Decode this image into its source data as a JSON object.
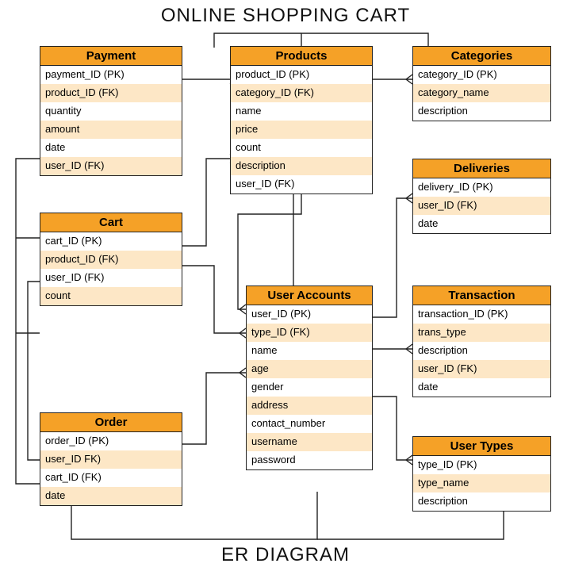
{
  "title_top": "ONLINE SHOPPING CART",
  "title_bottom": "ER DIAGRAM",
  "entities": {
    "payment": {
      "name": "Payment",
      "fields": [
        "payment_ID (PK)",
        "product_ID (FK)",
        "quantity",
        "amount",
        "date",
        "user_ID (FK)"
      ]
    },
    "products": {
      "name": "Products",
      "fields": [
        "product_ID (PK)",
        "category_ID (FK)",
        "name",
        "price",
        "count",
        "description",
        "user_ID (FK)"
      ]
    },
    "categories": {
      "name": "Categories",
      "fields": [
        "category_ID (PK)",
        "category_name",
        "description"
      ]
    },
    "deliveries": {
      "name": "Deliveries",
      "fields": [
        "delivery_ID (PK)",
        "user_ID (FK)",
        "date"
      ]
    },
    "cart": {
      "name": "Cart",
      "fields": [
        "cart_ID (PK)",
        "product_ID (FK)",
        "user_ID (FK)",
        "count"
      ]
    },
    "user_accounts": {
      "name": "User Accounts",
      "fields": [
        "user_ID (PK)",
        "type_ID (FK)",
        "name",
        "age",
        "gender",
        "address",
        "contact_number",
        "username",
        "password"
      ]
    },
    "transaction": {
      "name": "Transaction",
      "fields": [
        "transaction_ID (PK)",
        "trans_type",
        "description",
        "user_ID (FK)",
        "date"
      ]
    },
    "order": {
      "name": "Order",
      "fields": [
        "order_ID (PK)",
        "user_ID FK)",
        "cart_ID (FK)",
        "date"
      ]
    },
    "user_types": {
      "name": "User Types",
      "fields": [
        "type_ID (PK)",
        "type_name",
        "description"
      ]
    }
  }
}
